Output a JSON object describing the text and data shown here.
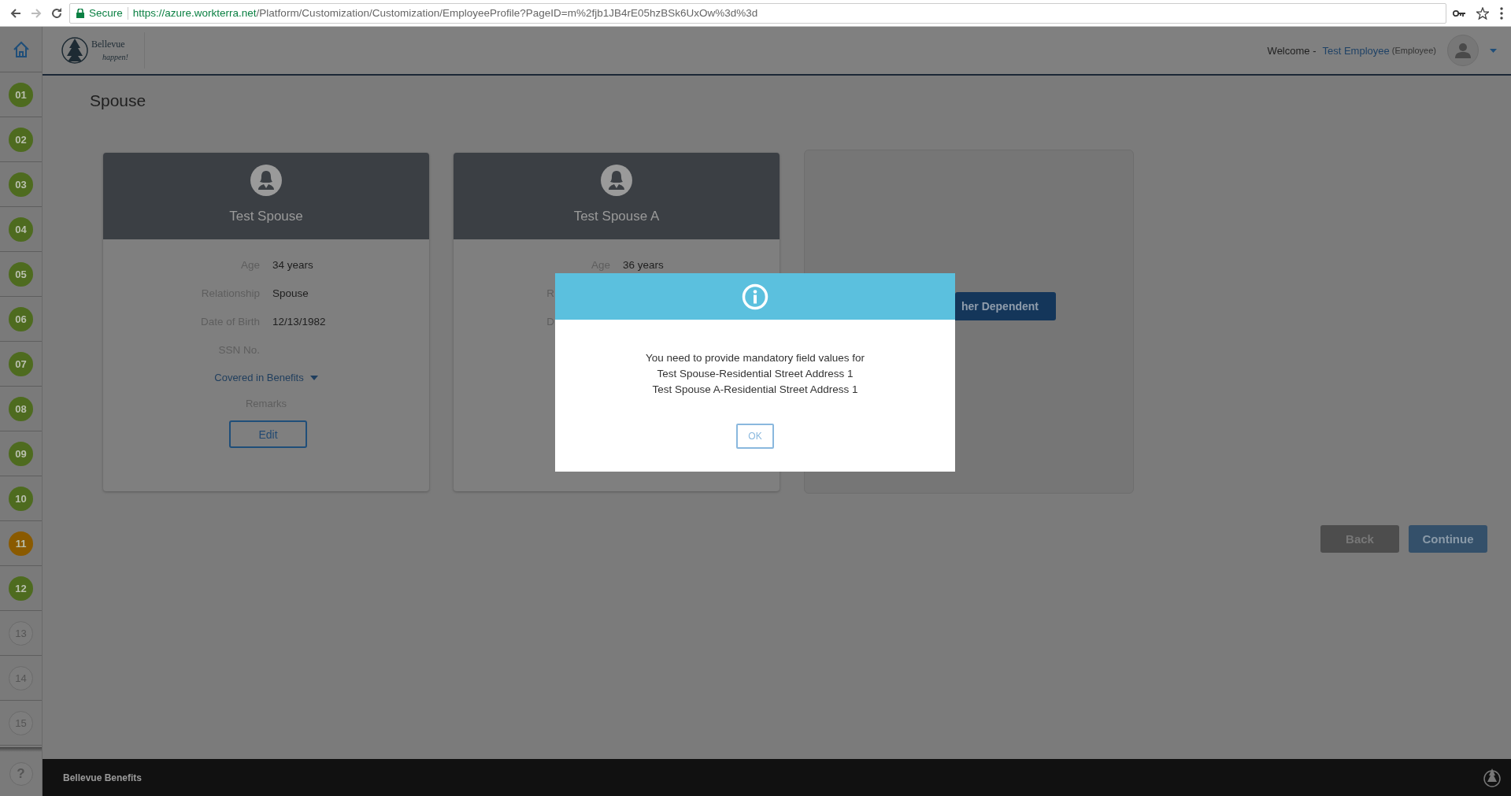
{
  "browser": {
    "secure_label": "Secure",
    "url_host": "https://azure.workterra.net",
    "url_path": "/Platform/Customization/Customization/EmployeeProfile?PageID=m%2fjb1JB4rE05hzBSk6UxOw%3d%3d"
  },
  "header": {
    "logo_name": "Bellevue",
    "logo_tagline": "happen!",
    "welcome": "Welcome -",
    "user_name": "Test Employee",
    "user_role": "(Employee)"
  },
  "sidebar": {
    "steps": [
      {
        "label": "01",
        "color": "#4e6b1f",
        "disabled": false
      },
      {
        "label": "02",
        "color": "#4e6b1f",
        "disabled": false
      },
      {
        "label": "03",
        "color": "#4e6b1f",
        "disabled": false
      },
      {
        "label": "04",
        "color": "#4e6b1f",
        "disabled": false
      },
      {
        "label": "05",
        "color": "#4e6b1f",
        "disabled": false
      },
      {
        "label": "06",
        "color": "#4e6b1f",
        "disabled": false
      },
      {
        "label": "07",
        "color": "#4e6b1f",
        "disabled": false
      },
      {
        "label": "08",
        "color": "#4e6b1f",
        "disabled": false
      },
      {
        "label": "09",
        "color": "#4e6b1f",
        "disabled": false
      },
      {
        "label": "10",
        "color": "#4e6b1f",
        "disabled": false
      },
      {
        "label": "11",
        "color": "#8a5a00",
        "disabled": false
      },
      {
        "label": "12",
        "color": "#4e6b1f",
        "disabled": false
      },
      {
        "label": "13",
        "color": "#7d7d7d",
        "disabled": true
      },
      {
        "label": "14",
        "color": "#7d7d7d",
        "disabled": true
      },
      {
        "label": "15",
        "color": "#7d7d7d",
        "disabled": true
      }
    ],
    "help": "?"
  },
  "page_title": "Spouse",
  "dependents": [
    {
      "name": "Test Spouse",
      "fields": [
        {
          "label": "Age",
          "value": "34 years",
          "kind": "full"
        },
        {
          "label": "Relationship",
          "value": "Spouse",
          "kind": "full"
        },
        {
          "label": "Date of Birth",
          "value": "12/13/1982",
          "kind": "full"
        },
        {
          "label": "SSN No.",
          "kind": "full"
        }
      ],
      "covered_link": "Covered in Benefits",
      "remarks_label": "Remarks",
      "edit_button": "Edit"
    },
    {
      "name": "Test Spouse A",
      "fields": [
        {
          "label": "Age",
          "value": "36 years",
          "kind": "full"
        },
        {
          "label": "R",
          "kind": "cut"
        },
        {
          "label": "D",
          "kind": "cut"
        }
      ]
    }
  ],
  "add_card": {
    "button": "her Dependent"
  },
  "buttons": [
    {
      "label": "Back",
      "kind": "secondary"
    },
    {
      "label": "Continue",
      "kind": "primary"
    }
  ],
  "dialog": {
    "lines": [
      "You need to provide mandatory field values for",
      "Test Spouse-Residential Street Address 1",
      "Test Spouse A-Residential Street Address 1"
    ],
    "ok_button": "OK"
  },
  "footer": {
    "title": "Bellevue Benefits"
  }
}
